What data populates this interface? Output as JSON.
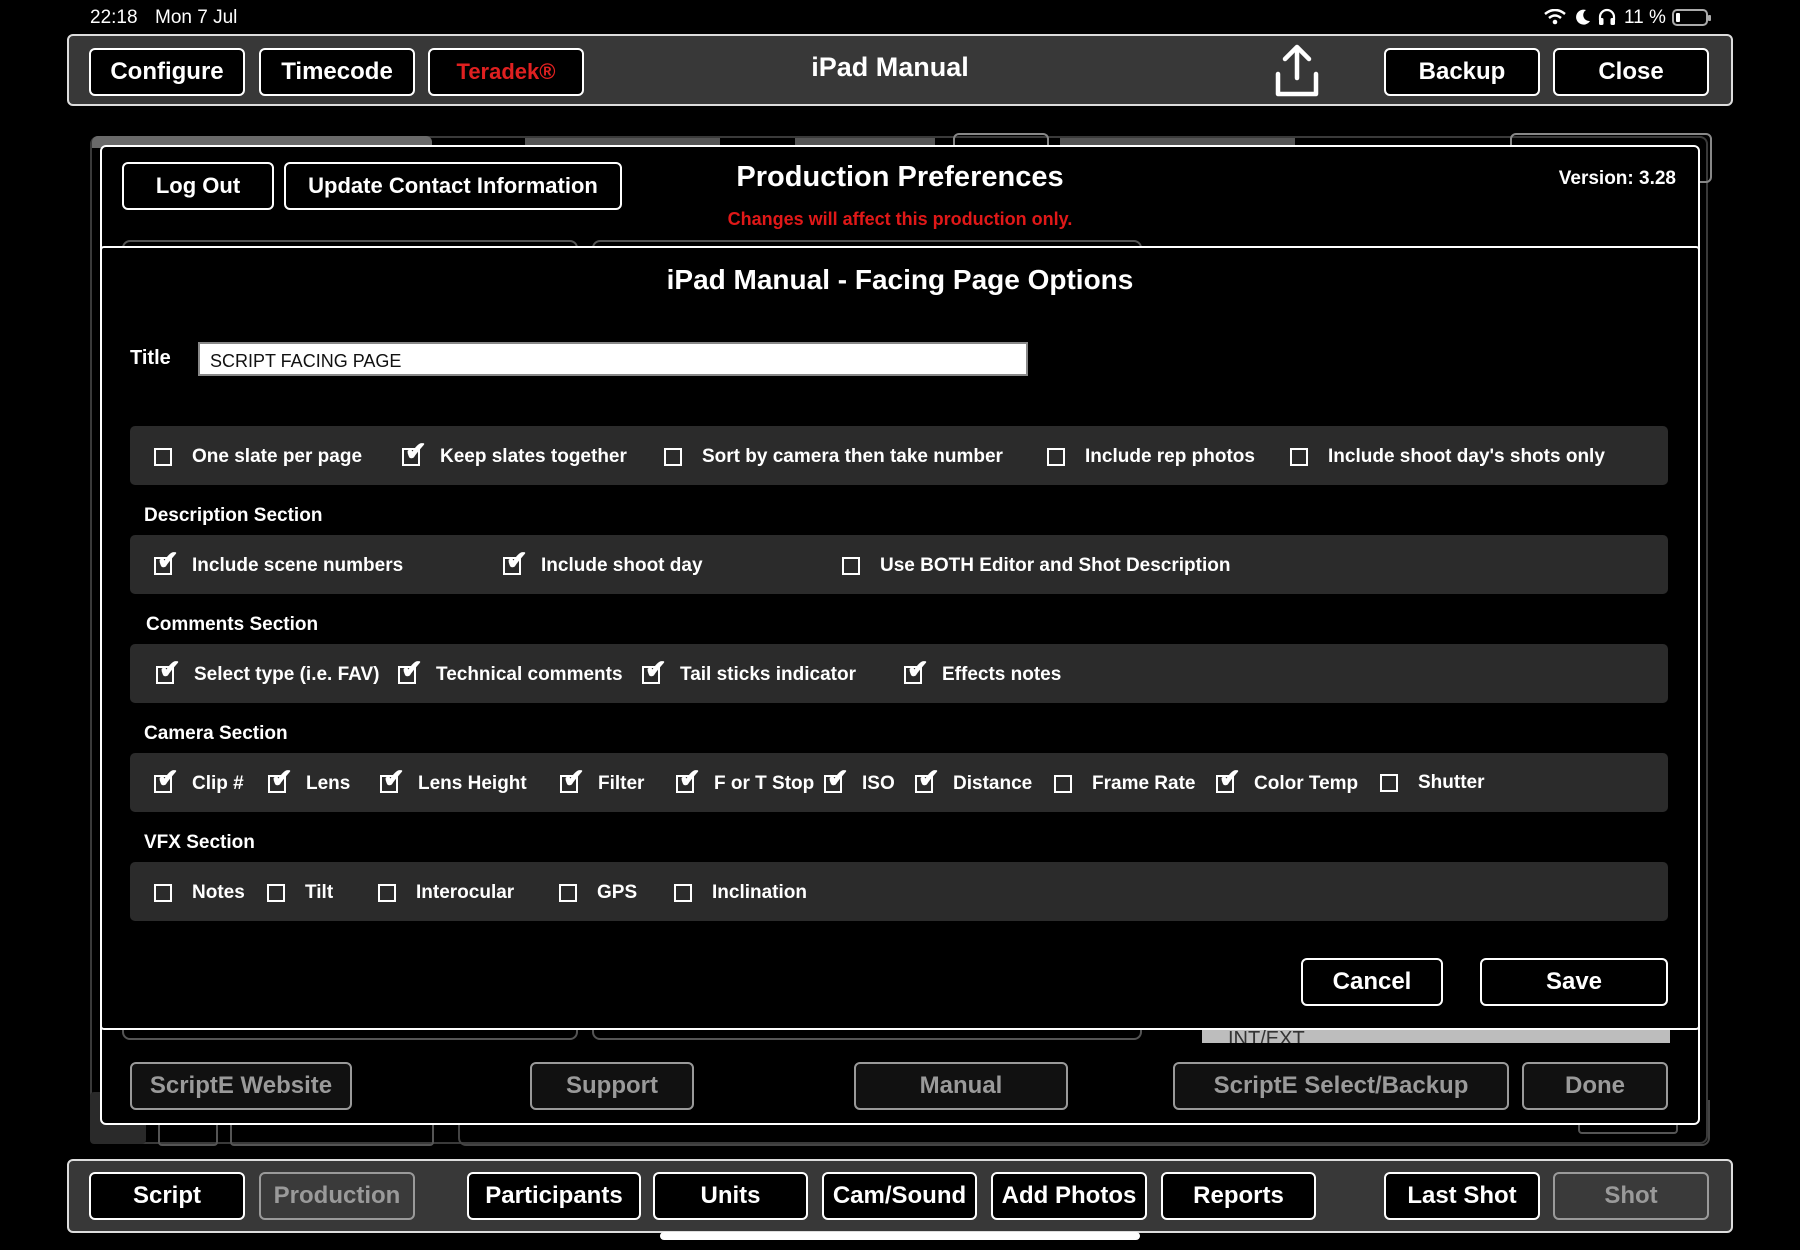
{
  "status_bar": {
    "time": "22:18",
    "date": "Mon 7 Jul",
    "battery_percent": "11 %"
  },
  "top_bar": {
    "configure": "Configure",
    "timecode": "Timecode",
    "teradek": "Teradek®",
    "title": "iPad Manual",
    "backup": "Backup",
    "close": "Close",
    "teradek_color": "#e02020"
  },
  "prefs": {
    "log_out": "Log Out",
    "update_contact": "Update Contact Information",
    "title": "Production Preferences",
    "subtitle": "Changes will affect this production only.",
    "version": "Version: 3.28",
    "scripte_website": "ScriptE Website",
    "support": "Support",
    "manual": "Manual",
    "scripte_select_backup": "ScriptE Select/Backup",
    "done": "Done",
    "int_ext": "INT/EXT"
  },
  "dialog": {
    "title": "iPad Manual - Facing Page Options",
    "title_label": "Title",
    "title_value": "SCRIPT FACING PAGE",
    "general_options": [
      {
        "label": "One slate per page",
        "checked": false
      },
      {
        "label": "Keep slates together",
        "checked": true
      },
      {
        "label": "Sort by camera then take number",
        "checked": false
      },
      {
        "label": "Include rep photos",
        "checked": false
      },
      {
        "label": "Include shoot day's shots only",
        "checked": false
      }
    ],
    "description_section": {
      "label": "Description Section",
      "options": [
        {
          "label": "Include scene numbers",
          "checked": true
        },
        {
          "label": "Include shoot day",
          "checked": true
        },
        {
          "label": "Use BOTH Editor and Shot Description",
          "checked": false
        }
      ]
    },
    "comments_section": {
      "label": "Comments Section",
      "options": [
        {
          "label": "Select type (i.e. FAV)",
          "checked": true
        },
        {
          "label": "Technical comments",
          "checked": true
        },
        {
          "label": "Tail sticks indicator",
          "checked": true
        },
        {
          "label": "Effects notes",
          "checked": true
        }
      ]
    },
    "camera_section": {
      "label": "Camera Section",
      "options": [
        {
          "label": "Clip #",
          "checked": true
        },
        {
          "label": "Lens",
          "checked": true
        },
        {
          "label": "Lens Height",
          "checked": true
        },
        {
          "label": "Filter",
          "checked": true
        },
        {
          "label": "F or T Stop",
          "checked": true
        },
        {
          "label": "ISO",
          "checked": true
        },
        {
          "label": "Distance",
          "checked": true
        },
        {
          "label": "Frame Rate",
          "checked": false
        },
        {
          "label": "Color Temp",
          "checked": true
        },
        {
          "label": "Shutter",
          "checked": false
        }
      ]
    },
    "vfx_section": {
      "label": "VFX Section",
      "options": [
        {
          "label": "Notes",
          "checked": false
        },
        {
          "label": "Tilt",
          "checked": false
        },
        {
          "label": "Interocular",
          "checked": false
        },
        {
          "label": "GPS",
          "checked": false
        },
        {
          "label": "Inclination",
          "checked": false
        }
      ]
    },
    "cancel": "Cancel",
    "save": "Save"
  },
  "bottom_bar": {
    "script": "Script",
    "production": "Production",
    "participants": "Participants",
    "units": "Units",
    "cam_sound": "Cam/Sound",
    "add_photos": "Add Photos",
    "reports": "Reports",
    "last_shot": "Last Shot",
    "shot": "Shot"
  },
  "icons": [
    "wifi-icon",
    "moon-icon",
    "headphones-icon",
    "battery-icon",
    "share-icon"
  ]
}
